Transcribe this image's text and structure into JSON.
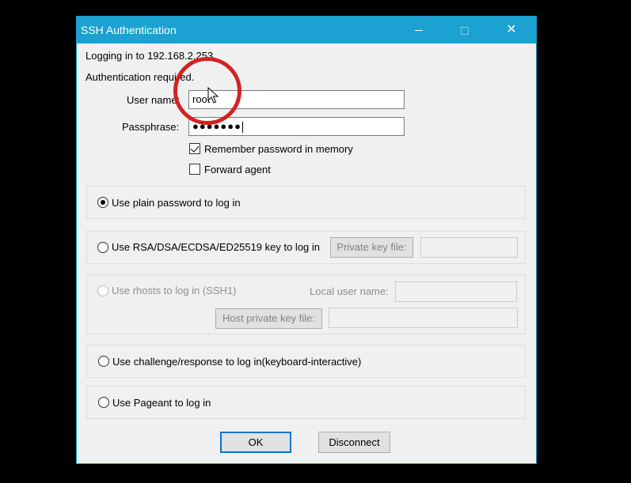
{
  "window": {
    "title": "SSH Authentication"
  },
  "titlebar": {
    "minimize": "minimize",
    "maximize": "maximize",
    "close": "✕"
  },
  "info": {
    "login_line": "Logging in to 192.168.2.253",
    "auth_line": "Authentication required."
  },
  "form": {
    "username_label": "User name:",
    "username_value": "root",
    "passphrase_label": "Passphrase:",
    "passphrase_mask": "●●●●●●●",
    "remember_label": "Remember password in memory",
    "remember_checked": true,
    "forward_label": "Forward agent",
    "forward_checked": false
  },
  "methods": {
    "plain": {
      "label": "Use plain password to log in",
      "selected": true
    },
    "rsa": {
      "label": "Use RSA/DSA/ECDSA/ED25519 key to log in",
      "keyfile_button": "Private key file:",
      "keyfile_value": ""
    },
    "rhosts": {
      "label": "Use rhosts to log in (SSH1)",
      "local_user_label": "Local user name:",
      "local_user_value": "",
      "host_key_button": "Host private key file:",
      "host_key_value": ""
    },
    "challenge": {
      "label": "Use challenge/response to log in(keyboard-interactive)"
    },
    "pageant": {
      "label": "Use Pageant to log in"
    }
  },
  "buttons": {
    "ok": "OK",
    "disconnect": "Disconnect"
  },
  "icons": {
    "minimize": "minimize-icon",
    "maximize": "maximize-icon",
    "close": "close-icon",
    "cursor": "mouse-cursor-icon"
  },
  "colors": {
    "titlebar": "#1ba1d2",
    "annotation": "#d32222",
    "default_button_border": "#0078d7"
  }
}
